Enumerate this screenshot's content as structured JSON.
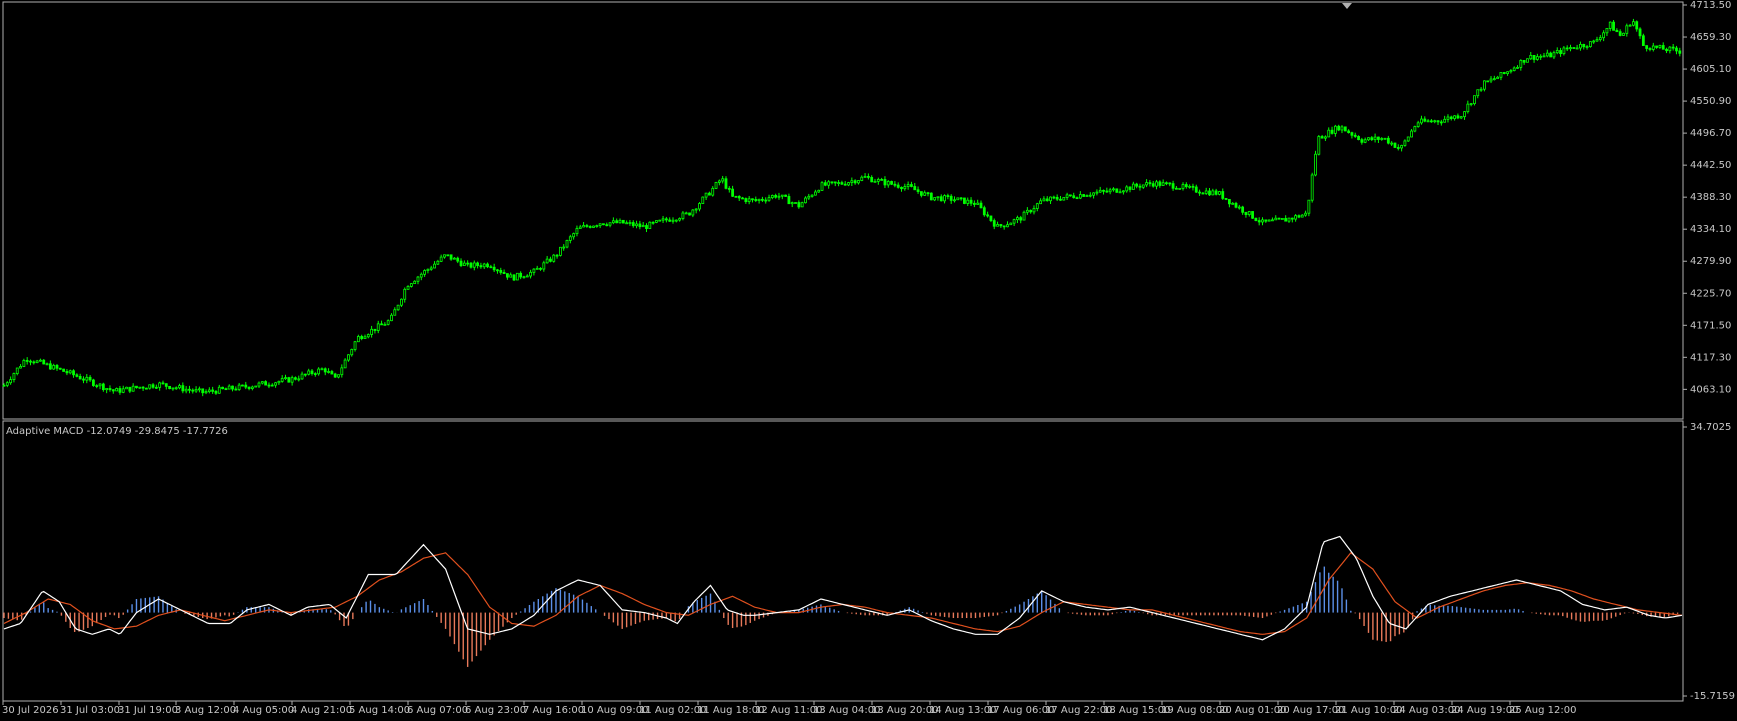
{
  "toolbar": {
    "icons": [
      "trading-panel-icon",
      "depth-of-market-icon"
    ]
  },
  "indicator": {
    "label": "Adaptive MACD -12.0749 -29.8475 -17.7726"
  },
  "colors": {
    "background": "#000000",
    "candle": "#00ff00",
    "axis_text": "#c8c8c8",
    "macd_line": "#ffffff",
    "signal_line": "#e0501e",
    "hist_positive": "#5b8fe8",
    "hist_negative": "#e8795a"
  },
  "chart_data": [
    {
      "type": "candlestick",
      "y_ticks": [
        "4713.50",
        "4659.30",
        "4605.10",
        "4550.90",
        "4496.70",
        "4442.50",
        "4388.30",
        "4334.10",
        "4279.90",
        "4225.70",
        "4171.50",
        "4117.30",
        "4063.10"
      ],
      "ylim": [
        4018,
        4713.5
      ],
      "close_profile": [
        [
          0,
          4070
        ],
        [
          20,
          4116
        ],
        [
          60,
          4090
        ],
        [
          100,
          4060
        ],
        [
          140,
          4072
        ],
        [
          180,
          4058
        ],
        [
          220,
          4068
        ],
        [
          260,
          4080
        ],
        [
          290,
          4098
        ],
        [
          300,
          4080
        ],
        [
          320,
          4150
        ],
        [
          350,
          4180
        ],
        [
          365,
          4240
        ],
        [
          385,
          4268
        ],
        [
          400,
          4290
        ],
        [
          420,
          4272
        ],
        [
          440,
          4275
        ],
        [
          460,
          4252
        ],
        [
          480,
          4262
        ],
        [
          500,
          4290
        ],
        [
          520,
          4335
        ],
        [
          540,
          4345
        ],
        [
          560,
          4345
        ],
        [
          580,
          4338
        ],
        [
          600,
          4350
        ],
        [
          620,
          4360
        ],
        [
          640,
          4398
        ],
        [
          650,
          4420
        ],
        [
          660,
          4388
        ],
        [
          680,
          4382
        ],
        [
          700,
          4392
        ],
        [
          720,
          4374
        ],
        [
          740,
          4408
        ],
        [
          760,
          4412
        ],
        [
          780,
          4422
        ],
        [
          800,
          4412
        ],
        [
          820,
          4405
        ],
        [
          840,
          4388
        ],
        [
          860,
          4385
        ],
        [
          880,
          4378
        ],
        [
          900,
          4338
        ],
        [
          920,
          4352
        ],
        [
          940,
          4382
        ],
        [
          960,
          4388
        ],
        [
          980,
          4394
        ],
        [
          1000,
          4398
        ],
        [
          1020,
          4405
        ],
        [
          1040,
          4412
        ],
        [
          1060,
          4408
        ],
        [
          1080,
          4400
        ],
        [
          1100,
          4395
        ],
        [
          1115,
          4375
        ],
        [
          1140,
          4345
        ],
        [
          1160,
          4350
        ],
        [
          1180,
          4360
        ],
        [
          1190,
          4488
        ],
        [
          1210,
          4508
        ],
        [
          1230,
          4485
        ],
        [
          1250,
          4488
        ],
        [
          1265,
          4470
        ],
        [
          1280,
          4515
        ],
        [
          1300,
          4518
        ],
        [
          1320,
          4528
        ],
        [
          1340,
          4580
        ],
        [
          1360,
          4598
        ],
        [
          1380,
          4625
        ],
        [
          1400,
          4628
        ],
        [
          1420,
          4642
        ],
        [
          1440,
          4650
        ],
        [
          1455,
          4680
        ],
        [
          1465,
          4660
        ],
        [
          1475,
          4690
        ],
        [
          1485,
          4645
        ],
        [
          1500,
          4640
        ],
        [
          1520,
          4635
        ]
      ],
      "x_ticks": [
        "30 Jul 2026",
        "31 Jul 03:00",
        "31 Jul 19:00",
        "3 Aug 12:00",
        "4 Aug 05:00",
        "4 Aug 21:00",
        "5 Aug 14:00",
        "6 Aug 07:00",
        "6 Aug 23:00",
        "7 Aug 16:00",
        "10 Aug 09:00",
        "11 Aug 02:00",
        "11 Aug 18:00",
        "12 Aug 11:00",
        "13 Aug 04:00",
        "13 Aug 20:00",
        "14 Aug 13:00",
        "17 Aug 06:00",
        "17 Aug 22:00",
        "18 Aug 15:00",
        "19 Aug 08:00",
        "20 Aug 01:00",
        "20 Aug 17:00",
        "21 Aug 10:00",
        "24 Aug 03:00",
        "24 Aug 19:00",
        "25 Aug 12:00"
      ],
      "x_tick_pos": [
        2,
        60,
        118,
        175,
        233,
        291,
        349,
        407,
        465,
        523,
        581,
        639,
        697,
        755,
        813,
        871,
        929,
        987,
        1045,
        1103,
        1161,
        1219,
        1277,
        1335,
        1393,
        1451,
        1509
      ]
    },
    {
      "type": "line",
      "title": "Adaptive MACD -12.0749 -29.8475 -17.7726",
      "y_ticks": [
        "34.7025",
        "-15.7159"
      ],
      "ylim": [
        -15.7159,
        34.7025
      ],
      "zero_level": 0,
      "series": [
        {
          "points": [
            [
              0,
              -3
            ],
            [
              15,
              -2
            ],
            [
              35,
              4
            ],
            [
              50,
              2
            ],
            [
              65,
              -3
            ],
            [
              80,
              -4
            ],
            [
              95,
              -3
            ],
            [
              105,
              -4
            ],
            [
              120,
              0
            ],
            [
              140,
              2.5
            ],
            [
              160,
              0.5
            ],
            [
              185,
              -2
            ],
            [
              205,
              -2
            ],
            [
              220,
              0.5
            ],
            [
              240,
              1.5
            ],
            [
              260,
              -0.5
            ],
            [
              275,
              1
            ],
            [
              295,
              1.5
            ],
            [
              310,
              -1
            ],
            [
              330,
              7
            ],
            [
              355,
              7
            ],
            [
              380,
              12.5
            ],
            [
              400,
              8
            ],
            [
              420,
              -3
            ],
            [
              440,
              -4
            ],
            [
              460,
              -3
            ],
            [
              480,
              -0.5
            ],
            [
              500,
              4
            ],
            [
              520,
              6
            ],
            [
              540,
              5
            ],
            [
              560,
              0.5
            ],
            [
              580,
              0
            ],
            [
              600,
              -1
            ],
            [
              610,
              -2
            ],
            [
              625,
              2
            ],
            [
              640,
              5
            ],
            [
              655,
              0.5
            ],
            [
              670,
              -0.5
            ],
            [
              680,
              -0.5
            ],
            [
              700,
              0
            ],
            [
              720,
              0.5
            ],
            [
              740,
              2.5
            ],
            [
              760,
              1.5
            ],
            [
              780,
              0.5
            ],
            [
              800,
              -0.5
            ],
            [
              820,
              0.5
            ],
            [
              840,
              -1.5
            ],
            [
              860,
              -3
            ],
            [
              880,
              -4
            ],
            [
              900,
              -4
            ],
            [
              920,
              -1
            ],
            [
              940,
              4
            ],
            [
              960,
              2
            ],
            [
              980,
              1
            ],
            [
              1000,
              0.5
            ],
            [
              1020,
              1
            ],
            [
              1040,
              0
            ],
            [
              1060,
              -1
            ],
            [
              1080,
              -2
            ],
            [
              1100,
              -3
            ],
            [
              1120,
              -4
            ],
            [
              1140,
              -5
            ],
            [
              1160,
              -3
            ],
            [
              1180,
              1
            ],
            [
              1195,
              13
            ],
            [
              1210,
              14
            ],
            [
              1225,
              10
            ],
            [
              1240,
              3
            ],
            [
              1255,
              -2
            ],
            [
              1270,
              -3
            ],
            [
              1290,
              1.5
            ],
            [
              1310,
              3
            ],
            [
              1330,
              4
            ],
            [
              1350,
              5
            ],
            [
              1370,
              6
            ],
            [
              1390,
              5
            ],
            [
              1410,
              4
            ],
            [
              1430,
              1.5
            ],
            [
              1450,
              0.5
            ],
            [
              1470,
              1
            ],
            [
              1490,
              -0.5
            ],
            [
              1505,
              -1
            ],
            [
              1520,
              -0.5
            ]
          ]
        },
        {
          "points": [
            [
              0,
              -2
            ],
            [
              20,
              0
            ],
            [
              40,
              2.5
            ],
            [
              60,
              1.5
            ],
            [
              80,
              -1.5
            ],
            [
              100,
              -3
            ],
            [
              120,
              -2.5
            ],
            [
              140,
              -0.5
            ],
            [
              160,
              0.5
            ],
            [
              180,
              -0.5
            ],
            [
              200,
              -1.5
            ],
            [
              220,
              -0.5
            ],
            [
              240,
              0.5
            ],
            [
              260,
              0
            ],
            [
              280,
              0.5
            ],
            [
              300,
              1
            ],
            [
              320,
              3
            ],
            [
              340,
              6
            ],
            [
              360,
              7.5
            ],
            [
              380,
              10
            ],
            [
              400,
              11
            ],
            [
              420,
              7
            ],
            [
              440,
              1
            ],
            [
              460,
              -2
            ],
            [
              480,
              -2.5
            ],
            [
              500,
              -0.5
            ],
            [
              520,
              3
            ],
            [
              540,
              5
            ],
            [
              560,
              3.5
            ],
            [
              580,
              1.5
            ],
            [
              600,
              0
            ],
            [
              620,
              -0.5
            ],
            [
              640,
              1.5
            ],
            [
              660,
              3
            ],
            [
              680,
              1
            ],
            [
              700,
              0
            ],
            [
              720,
              0
            ],
            [
              740,
              1
            ],
            [
              760,
              1.5
            ],
            [
              780,
              1
            ],
            [
              800,
              0
            ],
            [
              820,
              -0.5
            ],
            [
              840,
              -1
            ],
            [
              860,
              -2
            ],
            [
              880,
              -3
            ],
            [
              900,
              -3.5
            ],
            [
              920,
              -2.5
            ],
            [
              940,
              0
            ],
            [
              960,
              2
            ],
            [
              980,
              1.5
            ],
            [
              1000,
              1
            ],
            [
              1020,
              0.5
            ],
            [
              1040,
              0.5
            ],
            [
              1060,
              -0.5
            ],
            [
              1080,
              -1.5
            ],
            [
              1100,
              -2.5
            ],
            [
              1120,
              -3.5
            ],
            [
              1140,
              -4
            ],
            [
              1160,
              -3.5
            ],
            [
              1180,
              -1
            ],
            [
              1200,
              6
            ],
            [
              1220,
              11
            ],
            [
              1240,
              8
            ],
            [
              1260,
              2
            ],
            [
              1280,
              -1
            ],
            [
              1300,
              1
            ],
            [
              1320,
              2.5
            ],
            [
              1340,
              4
            ],
            [
              1360,
              5
            ],
            [
              1380,
              5.5
            ],
            [
              1400,
              5
            ],
            [
              1420,
              4
            ],
            [
              1440,
              2.5
            ],
            [
              1460,
              1.5
            ],
            [
              1480,
              0.5
            ],
            [
              1500,
              0
            ],
            [
              1520,
              -0.5
            ]
          ]
        }
      ]
    }
  ]
}
